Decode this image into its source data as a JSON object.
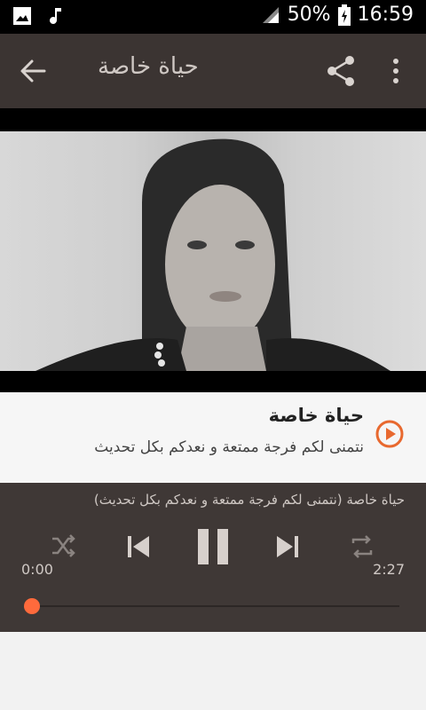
{
  "status_bar": {
    "battery": "50%",
    "time": "16:59",
    "icons": [
      "image-icon",
      "music-note-icon",
      "signal-icon",
      "battery-charging-icon"
    ]
  },
  "app_bar": {
    "title": "حياة خاصة",
    "icons": [
      "back-arrow-icon",
      "share-icon",
      "more-vert-icon"
    ]
  },
  "track": {
    "title": "حياة خاصة",
    "subtitle": "نتمنى لكم فرجة ممتعة و نعدكم بكل تحديث",
    "accent": "#e8692f"
  },
  "player": {
    "now_playing": "حياة خاصة (نتمنى لكم فرجة ممتعة و نعدكم بكل تحديث)",
    "elapsed": "0:00",
    "duration": "2:27",
    "progress": 0.0,
    "state": "playing",
    "controls": [
      "shuffle-icon",
      "previous-icon",
      "pause-icon",
      "next-icon",
      "repeat-icon"
    ],
    "thumb_color": "#ff6a3c"
  }
}
